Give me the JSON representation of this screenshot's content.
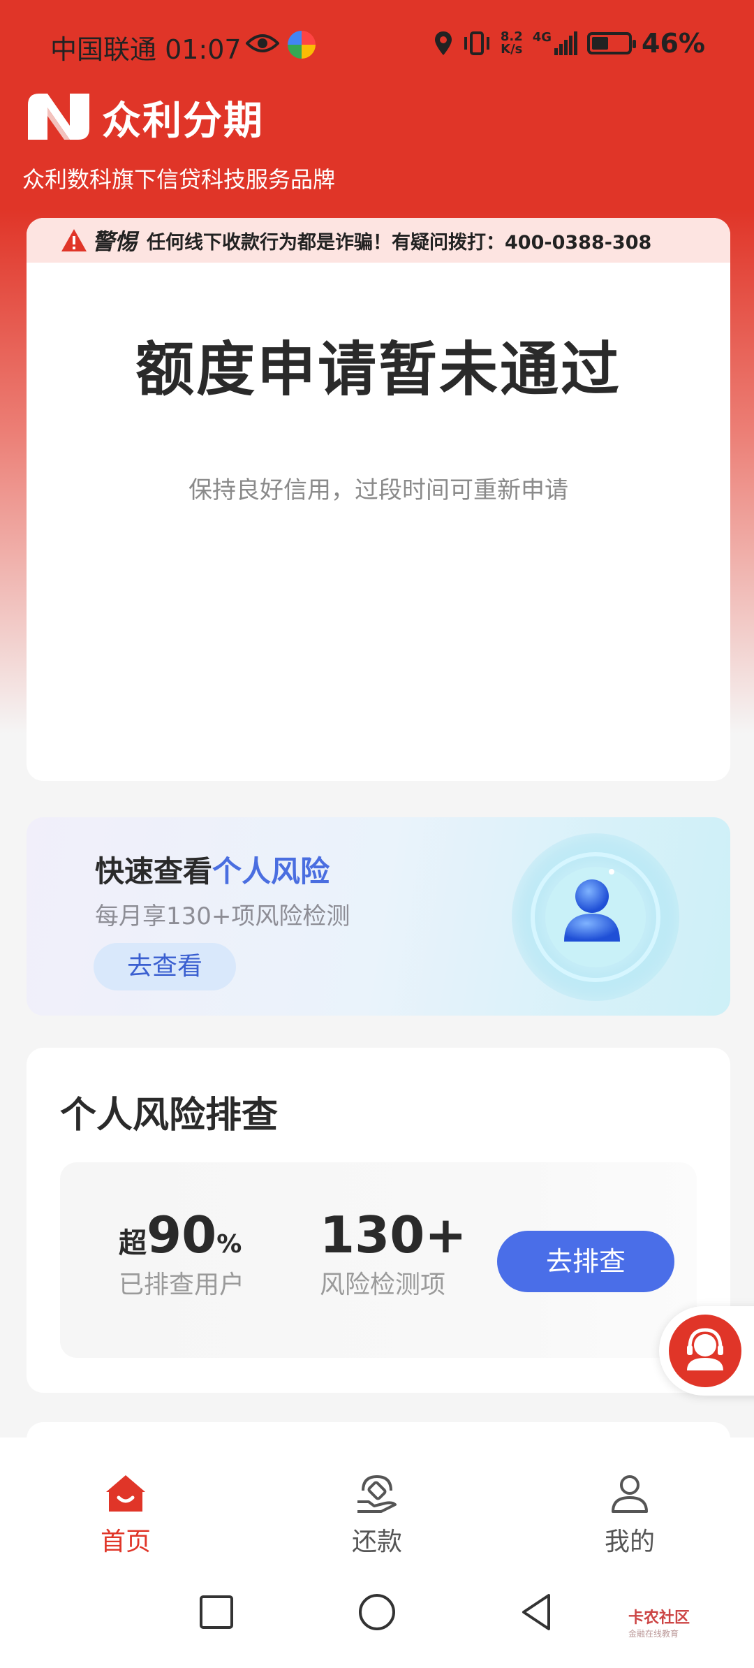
{
  "status_bar": {
    "carrier_time": "中国联通 01:07",
    "net_speed_top": "8.2",
    "net_speed_bottom": "K/s",
    "network": "4G",
    "battery": "46%",
    "battery_level": 0.46
  },
  "brand": {
    "name": "众利分期",
    "subtitle": "众利数科旗下信贷科技服务品牌"
  },
  "warning": {
    "label": "警惕",
    "text": "任何线下收款行为都是诈骗！有疑问拨打：400-0388-308"
  },
  "application": {
    "title": "额度申请暂未通过",
    "subtitle": "保持良好信用，过段时间可重新申请"
  },
  "risk_banner": {
    "title_prefix": "快速查看",
    "title_highlight": "个人风险",
    "subtitle": "每月享130+项风险检测",
    "button": "去查看"
  },
  "risk_check": {
    "title": "个人风险排查",
    "stat1_prefix": "超",
    "stat1_value": "90",
    "stat1_suffix": "%",
    "stat1_label": "已排查用户",
    "stat2_value": "130+",
    "stat2_label": "风险检测项",
    "button": "去排查"
  },
  "bottom_nav": {
    "items": [
      {
        "label": "首页",
        "active": true
      },
      {
        "label": "还款",
        "active": false
      },
      {
        "label": "我的",
        "active": false
      }
    ]
  },
  "watermark": {
    "title": "卡农社区",
    "subtitle": "金融在线教育"
  },
  "colors": {
    "brand_red": "#e03528",
    "accent_blue": "#4a6ee8",
    "warn_bg": "#fde4e1"
  }
}
